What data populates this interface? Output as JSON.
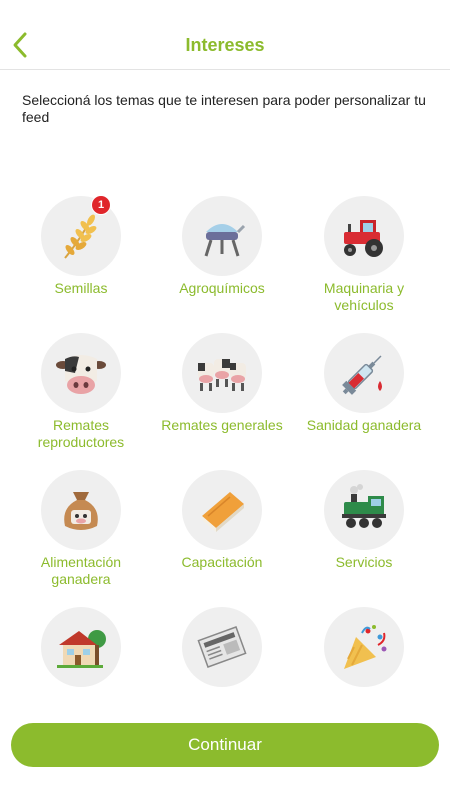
{
  "header": {
    "title": "Intereses",
    "back_icon": "chevron-left-icon"
  },
  "intro": "Seleccioná los temas que te interesen para poder personalizar tu feed",
  "topics": [
    {
      "label": "Semillas",
      "icon": "wheat-icon",
      "badge": "1"
    },
    {
      "label": "Agroquímicos",
      "icon": "alembic-icon"
    },
    {
      "label": "Maquinaria y vehículos",
      "icon": "tractor-icon"
    },
    {
      "label": "Remates reproductores",
      "icon": "cow-face-icon"
    },
    {
      "label": "Remates generales",
      "icon": "cows-icon"
    },
    {
      "label": "Sanidad ganadera",
      "icon": "syringe-icon"
    },
    {
      "label": "Alimentación ganadera",
      "icon": "feed-sack-icon"
    },
    {
      "label": "Capacitación",
      "icon": "book-icon"
    },
    {
      "label": "Servicios",
      "icon": "locomotive-icon"
    },
    {
      "label": "",
      "icon": "house-icon"
    },
    {
      "label": "",
      "icon": "newspaper-icon"
    },
    {
      "label": "",
      "icon": "party-popper-icon"
    }
  ],
  "colors": {
    "accent": "#8cbb2d",
    "badge": "#e0262b",
    "circle": "#efefef"
  },
  "footer": {
    "continue_label": "Continuar"
  }
}
